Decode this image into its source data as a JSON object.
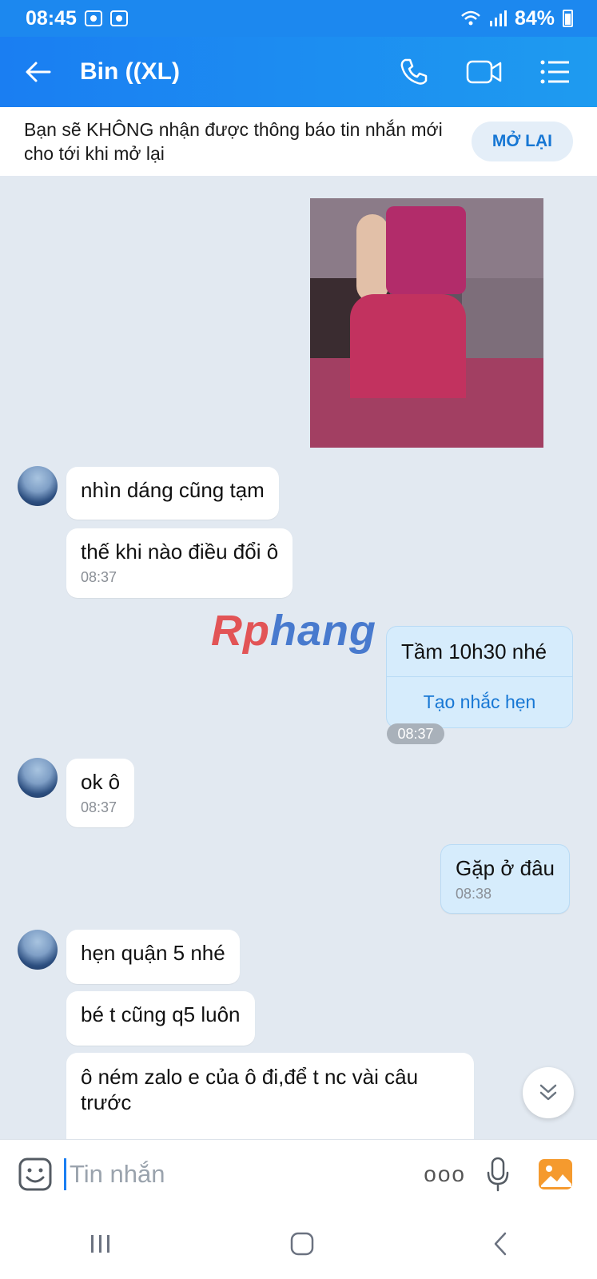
{
  "status_bar": {
    "time": "08:45",
    "battery": "84%"
  },
  "header": {
    "contact_name": "Bin ((XL)"
  },
  "banner": {
    "text": "Bạn sẽ KHÔNG nhận được thông báo tin nhắn mới cho tới khi mở lại",
    "button": "MỞ LẠI"
  },
  "watermark": {
    "part1": "Rp",
    "part2": "hang"
  },
  "messages": [
    {
      "side": "in",
      "text": "nhìn dáng cũng tạm"
    },
    {
      "side": "in",
      "text": "thế khi nào điều đổi ô",
      "time": "08:37"
    },
    {
      "side": "out",
      "text": "Tầm 10h30 nhé",
      "action": "Tạo nhắc hẹn",
      "time": "08:37"
    },
    {
      "side": "in",
      "text": "ok ô",
      "time": "08:37"
    },
    {
      "side": "out",
      "text": "Gặp ở đâu",
      "time": "08:38"
    },
    {
      "side": "in",
      "text": "hẹn quận 5 nhé"
    },
    {
      "side": "in",
      "text": "bé t cũng q5 luôn"
    },
    {
      "side": "in",
      "text": "ô ném zalo e của ô đi,để t nc vài câu trước"
    }
  ],
  "input": {
    "placeholder": "Tin nhắn",
    "more": "ooo"
  }
}
